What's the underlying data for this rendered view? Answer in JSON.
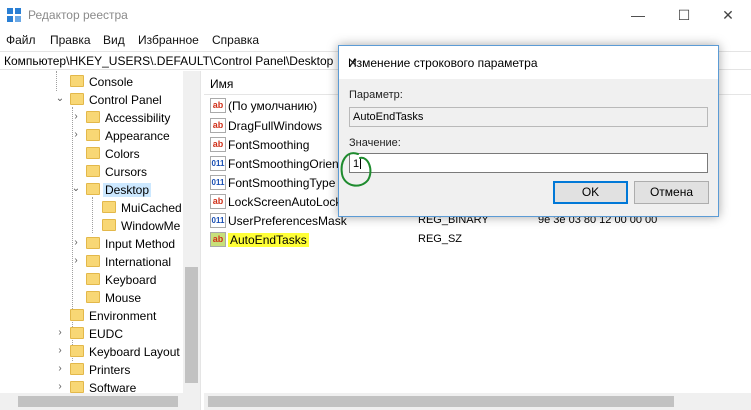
{
  "window": {
    "title": "Редактор реестра",
    "controls": {
      "minimize": "—",
      "maximize": "☐",
      "close": "✕"
    }
  },
  "menu": [
    "Файл",
    "Правка",
    "Вид",
    "Избранное",
    "Справка"
  ],
  "address": "Компьютер\\HKEY_USERS\\.DEFAULT\\Control Panel\\Desktop",
  "tree": {
    "items": [
      {
        "label": "Console",
        "expandable": false,
        "selected": false
      },
      {
        "label": "Control Panel",
        "expandable": true,
        "expanded": true,
        "selected": false
      },
      {
        "label": "Accessibility",
        "expandable": true,
        "selected": false
      },
      {
        "label": "Appearance",
        "expandable": true,
        "selected": false
      },
      {
        "label": "Colors",
        "expandable": false,
        "selected": false
      },
      {
        "label": "Cursors",
        "expandable": false,
        "selected": false
      },
      {
        "label": "Desktop",
        "expandable": true,
        "expanded": true,
        "selected": true
      },
      {
        "label": "MuiCached",
        "expandable": false,
        "selected": false
      },
      {
        "label": "WindowMe",
        "expandable": false,
        "selected": false
      },
      {
        "label": "Input Method",
        "expandable": true,
        "selected": false
      },
      {
        "label": "International",
        "expandable": true,
        "selected": false
      },
      {
        "label": "Keyboard",
        "expandable": false,
        "selected": false
      },
      {
        "label": "Mouse",
        "expandable": false,
        "selected": false
      },
      {
        "label": "Environment",
        "expandable": false,
        "selected": false
      },
      {
        "label": "EUDC",
        "expandable": true,
        "selected": false
      },
      {
        "label": "Keyboard Layout",
        "expandable": true,
        "selected": false
      },
      {
        "label": "Printers",
        "expandable": true,
        "selected": false
      },
      {
        "label": "Software",
        "expandable": true,
        "selected": false
      }
    ]
  },
  "values": {
    "column_name": "Имя",
    "rows": [
      {
        "name": "(По умолчанию)",
        "icon": "string-value-icon",
        "type": "",
        "data": ""
      },
      {
        "name": "DragFullWindows",
        "icon": "string-value-icon",
        "type": "",
        "data": ""
      },
      {
        "name": "FontSmoothing",
        "icon": "string-value-icon",
        "type": "",
        "data": ""
      },
      {
        "name": "FontSmoothingOrien",
        "icon": "binary-value-icon",
        "type": "",
        "data": ""
      },
      {
        "name": "FontSmoothingType",
        "icon": "binary-value-icon",
        "type": "",
        "data": ""
      },
      {
        "name": "LockScreenAutoLock",
        "icon": "string-value-icon",
        "type": "",
        "data": ""
      },
      {
        "name": "UserPreferencesMask",
        "icon": "binary-value-icon",
        "type": "REG_BINARY",
        "data": "9e 3e 03 80 12 00 00 00"
      },
      {
        "name": "AutoEndTasks",
        "icon": "string-value-icon",
        "type": "REG_SZ",
        "data": "",
        "highlighted": true
      }
    ]
  },
  "dialog": {
    "title": "Изменение строкового параметра",
    "close": "✕",
    "param_label": "Параметр:",
    "param_value": "AutoEndTasks",
    "value_label": "Значение:",
    "value": "1",
    "ok_label": "OK",
    "cancel_label": "Отмена"
  },
  "colors": {
    "highlight": "#ffff37",
    "selection": "#cce8ff",
    "accent": "#0078d7",
    "annotation": "#1e8b2e"
  }
}
